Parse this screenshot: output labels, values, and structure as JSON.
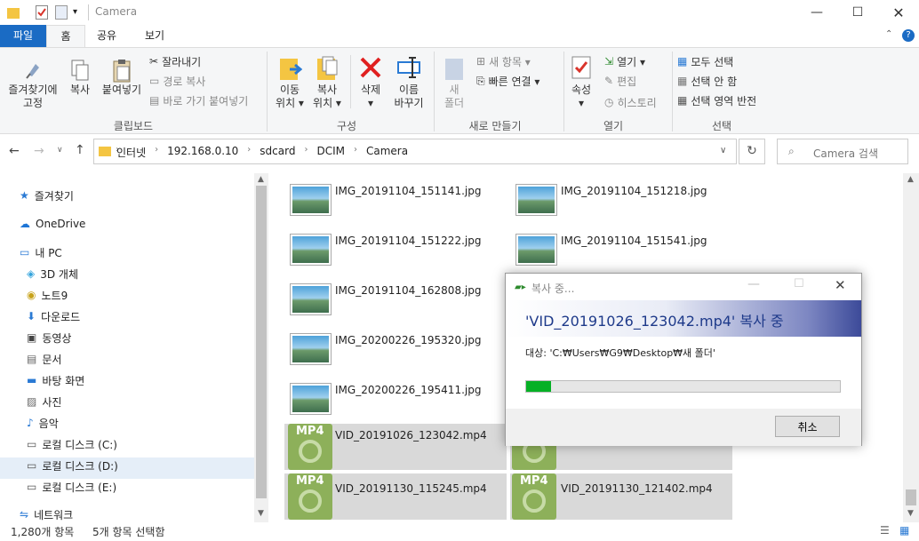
{
  "window": {
    "title": "Camera"
  },
  "tabs": [
    "파일",
    "홈",
    "공유",
    "보기"
  ],
  "ribbon": {
    "clipboard": {
      "label": "클립보드",
      "pin": "즐겨찾기에\n고정",
      "copy": "복사",
      "paste": "붙여넣기",
      "cut": "잘라내기",
      "copy_path": "경로 복사",
      "paste_shortcut": "바로 가기 붙여넣기"
    },
    "organize": {
      "label": "구성",
      "move": "이동\n위치 ▾",
      "copy_to": "복사\n위치 ▾",
      "delete": "삭제\n▾",
      "rename": "이름\n바꾸기"
    },
    "new": {
      "label": "새로 만들기",
      "new_folder": "새\n폴더",
      "new_item": "새 항목 ▾",
      "easy_access": "빠른 연결 ▾"
    },
    "open": {
      "label": "열기",
      "properties": "속성\n▾",
      "open": "열기 ▾",
      "edit": "편집",
      "history": "히스토리"
    },
    "select": {
      "label": "선택",
      "all": "모두 선택",
      "none": "선택 안 함",
      "invert": "선택 영역 반전"
    }
  },
  "address": {
    "crumbs": [
      "인터넷",
      "192.168.0.10",
      "sdcard",
      "DCIM",
      "Camera"
    ]
  },
  "search": {
    "placeholder": "Camera 검색"
  },
  "sidebar": {
    "items": [
      "즐겨찾기",
      "OneDrive",
      "내 PC",
      "3D 개체",
      "노트9",
      "다운로드",
      "동영상",
      "문서",
      "바탕 화면",
      "사진",
      "음악",
      "로컬 디스크 (C:)",
      "로컬 디스크 (D:)",
      "로컬 디스크 (E:)",
      "네트워크"
    ]
  },
  "files": [
    {
      "name": "IMG_20191104_151141.jpg",
      "type": "jpg"
    },
    {
      "name": "IMG_20191104_151218.jpg",
      "type": "jpg"
    },
    {
      "name": "IMG_20191104_151222.jpg",
      "type": "jpg"
    },
    {
      "name": "IMG_20191104_151541.jpg",
      "type": "jpg"
    },
    {
      "name": "IMG_20191104_162808.jpg",
      "type": "jpg"
    },
    {
      "name": "IMG_20200226_195320.jpg",
      "type": "jpg"
    },
    {
      "name": "IMG_20200226_195411.jpg",
      "type": "jpg"
    },
    {
      "name": "VID_20191026_123042.mp4",
      "type": "mp4"
    },
    {
      "name": "",
      "type": "mp4"
    },
    {
      "name": "VID_20191130_115245.mp4",
      "type": "mp4"
    },
    {
      "name": "VID_20191130_121402.mp4",
      "type": "mp4"
    }
  ],
  "mp4_badge": "MP4",
  "status": {
    "count": "1,280개 항목",
    "selected": "5개 항목 선택함"
  },
  "dialog": {
    "title": "복사 중...",
    "heading": "'VID_20191026_123042.mp4' 복사 중",
    "dest": "대상: 'C:₩Users₩G9₩Desktop₩새 폴더'",
    "progress": 0.08,
    "cancel": "취소"
  }
}
